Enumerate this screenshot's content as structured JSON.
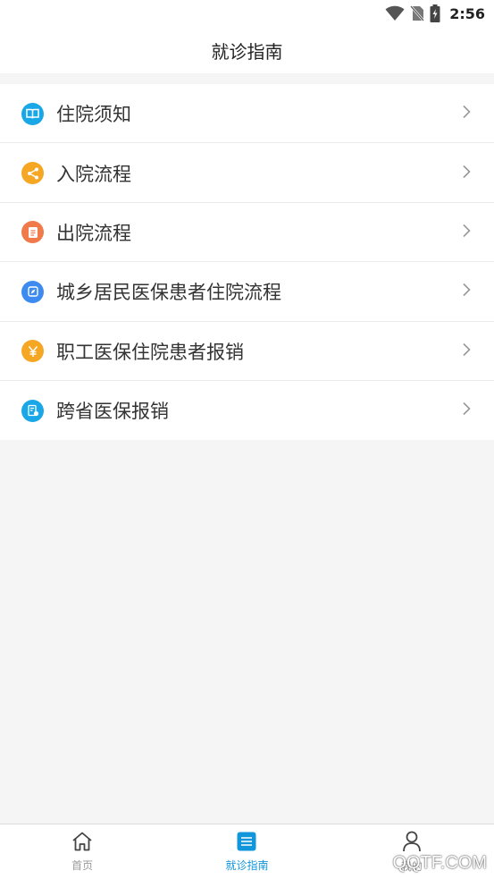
{
  "status_bar": {
    "time": "2:56",
    "icons": [
      "wifi-icon",
      "no-sim-icon",
      "battery-icon"
    ]
  },
  "header": {
    "title": "就诊指南"
  },
  "menu": {
    "items": [
      {
        "label": "住院须知",
        "icon": "book-icon",
        "color": "#1aa7e8"
      },
      {
        "label": "入院流程",
        "icon": "share-flow-icon",
        "color": "#f5a623"
      },
      {
        "label": "出院流程",
        "icon": "document-icon",
        "color": "#f07a4a"
      },
      {
        "label": "城乡居民医保患者住院流程",
        "icon": "compass-icon",
        "color": "#3d8af0"
      },
      {
        "label": "职工医保住院患者报销",
        "icon": "yuan-icon",
        "color": "#f5a623"
      },
      {
        "label": "跨省医保报销",
        "icon": "receipt-icon",
        "color": "#1aa7e8"
      }
    ]
  },
  "tabbar": {
    "tabs": [
      {
        "label": "首页",
        "icon": "home-icon",
        "active": false
      },
      {
        "label": "就诊指南",
        "icon": "guide-list-icon",
        "active": true
      },
      {
        "label": "我的",
        "icon": "user-icon",
        "active": false
      }
    ],
    "active_color": "#1296db",
    "inactive_color": "#999999"
  },
  "watermark": "QQTF.COM"
}
